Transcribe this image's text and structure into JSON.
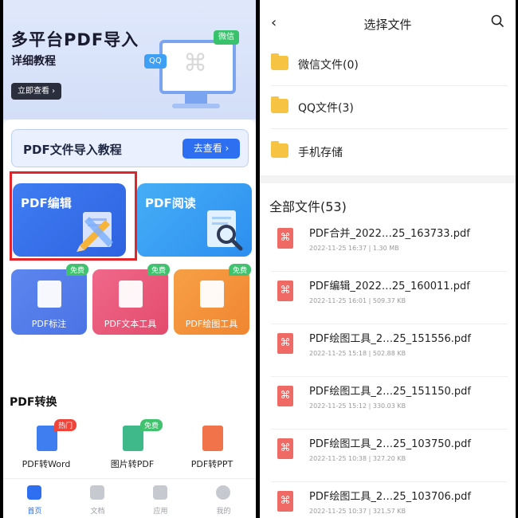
{
  "left": {
    "banner": {
      "title": "多平台PDF导入",
      "subtitle": "详细教程",
      "button": "立即查看 ›",
      "wechat_bubble": "微信",
      "qq_bubble": "QQ"
    },
    "guide": {
      "title": "PDF文件导入教程",
      "button": "去查看 ›"
    },
    "cards": [
      {
        "label": "PDF编辑",
        "icon": "pencil-ruler-icon"
      },
      {
        "label": "PDF阅读",
        "icon": "magnifier-icon"
      }
    ],
    "tools": [
      {
        "label": "PDF标注",
        "badge": "免费",
        "icon": "comment-icon"
      },
      {
        "label": "PDF文本工具",
        "badge": "免费",
        "icon": "text-icon"
      },
      {
        "label": "PDF绘图工具",
        "badge": "免费",
        "icon": "palette-icon"
      }
    ],
    "convert_section": "PDF转换",
    "convert": [
      {
        "label": "PDF转Word",
        "badge": "热门"
      },
      {
        "label": "图片转PDF",
        "badge": "免费"
      },
      {
        "label": "PDF转PPT",
        "badge": ""
      }
    ],
    "tabs": [
      {
        "label": "首页",
        "active": true
      },
      {
        "label": "文档",
        "active": false
      },
      {
        "label": "应用",
        "active": false
      },
      {
        "label": "我的",
        "active": false
      }
    ]
  },
  "right": {
    "title": "选择文件",
    "folders": [
      {
        "label": "微信文件(0)",
        "icon": "wechat-folder-icon"
      },
      {
        "label": "QQ文件(3)",
        "icon": "qq-folder-icon"
      },
      {
        "label": "手机存储",
        "icon": "storage-folder-icon"
      }
    ],
    "all_files_title": "全部文件(53)",
    "files": [
      {
        "name": "PDF合并_2022…25_163733.pdf",
        "meta": "2022-11-25 16:37  |  1.30 MB"
      },
      {
        "name": "PDF编辑_2022…25_160011.pdf",
        "meta": "2022-11-25 16:01  |  509.37 KB"
      },
      {
        "name": "PDF绘图工具_2…25_151556.pdf",
        "meta": "2022-11-25 15:18  |  502.88 KB"
      },
      {
        "name": "PDF绘图工具_2…25_151150.pdf",
        "meta": "2022-11-25 15:12  |  330.03 KB"
      },
      {
        "name": "PDF绘图工具_2…25_103750.pdf",
        "meta": "2022-11-25 10:38  |  327.20 KB"
      },
      {
        "name": "PDF绘图工具_2…25_103706.pdf",
        "meta": "2022-11-25 10:37  |  321.57 KB"
      }
    ]
  }
}
